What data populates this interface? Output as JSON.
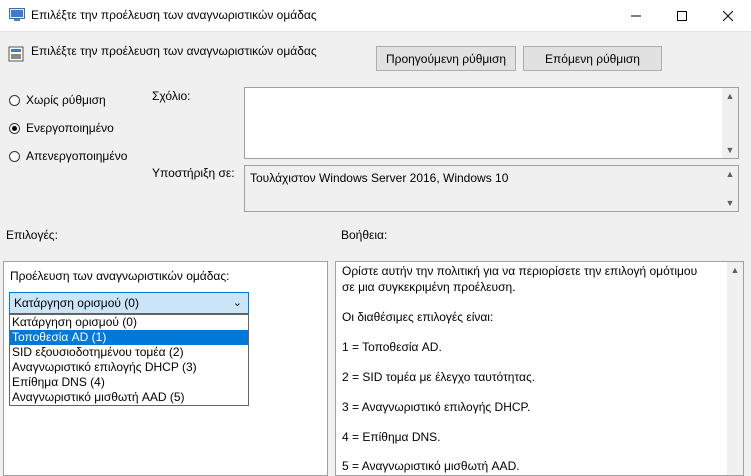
{
  "window": {
    "title": "Επιλέξτε την προέλευση των αναγνωριστικών ομάδας"
  },
  "header": {
    "title": "Επιλέξτε την προέλευση των αναγνωριστικών ομάδας",
    "prev_button": "Προηγούμενη ρύθμιση",
    "next_button": "Επόμενη ρύθμιση"
  },
  "state": {
    "options": [
      {
        "label": "Χωρίς ρύθμιση",
        "checked": false
      },
      {
        "label": "Ενεργοποιημένο",
        "checked": true
      },
      {
        "label": "Απενεργοποιημένο",
        "checked": false
      }
    ]
  },
  "comment": {
    "label": "Σχόλιο:",
    "value": ""
  },
  "supported": {
    "label": "Υποστήριξη σε:",
    "value": "Τουλάχιστον Windows Server 2016, Windows 10"
  },
  "options_section": {
    "label": "Επιλογές:",
    "field_label": "Προέλευση των αναγνωριστικών ομάδας:",
    "selected": "Κατάργηση ορισμού (0)",
    "items": [
      "Κατάργηση ορισμού (0)",
      "Τοποθεσία AD (1)",
      "SID εξουσιοδοτημένου τομέα (2)",
      "Αναγνωριστικό επιλογής DHCP (3)",
      "Επίθημα DNS (4)",
      "Αναγνωριστικό μισθωτή AAD (5)"
    ],
    "highlighted_index": 1
  },
  "help": {
    "label": "Βοήθεια:",
    "lines": [
      "Ορίστε αυτήν την πολιτική για να περιορίσετε την επιλογή ομότιμου",
      "σε μια συγκεκριμένη προέλευση.",
      "Οι διαθέσιμες επιλογές είναι:",
      "1 = Τοποθεσία AD.",
      "2 = SID τομέα με έλεγχο ταυτότητας.",
      "3 = Αναγνωριστικό επιλογής DHCP.",
      "4 = Επίθημα DNS.",
      "5 = Αναγνωριστικό μισθωτή AAD."
    ]
  },
  "icons": {
    "app": "policy-icon",
    "minimize": "minimize-icon",
    "maximize": "maximize-icon",
    "close": "close-icon"
  },
  "colors": {
    "selection": "#0078d7",
    "select_bg": "#cce4f7"
  }
}
